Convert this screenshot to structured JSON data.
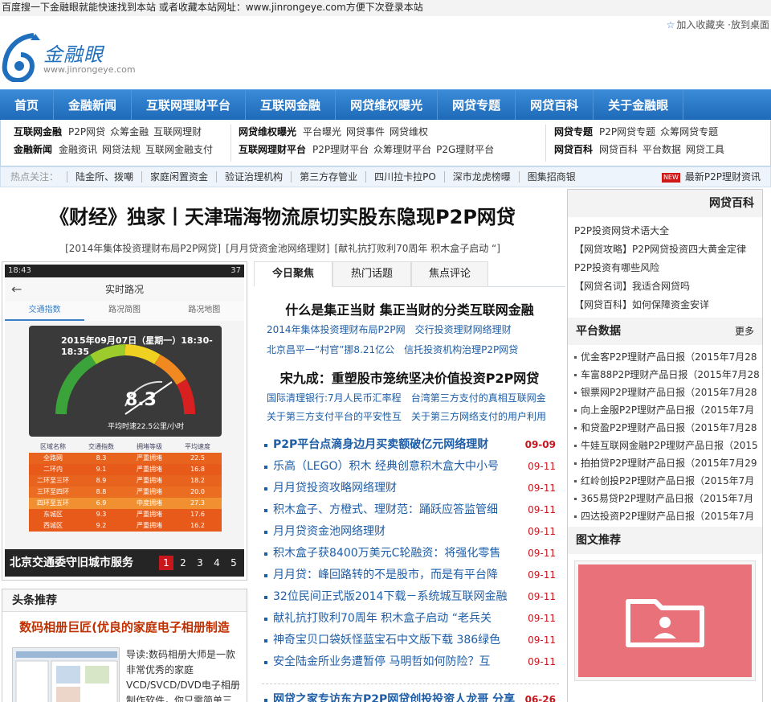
{
  "topbar": {
    "notice": "百度搜一下金融眼就能快速找到本站 或者收藏本站网址：www.jinrongeye.com方便下次登录本站",
    "bookmark": "加入收藏夹",
    "desktop": "·放到桌面"
  },
  "logo": {
    "cn": "金融眼",
    "en": "www.jinrongeye.com"
  },
  "nav": [
    "首页",
    "金融新闻",
    "互联网理财平台",
    "互联网金融",
    "网贷维权曝光",
    "网贷专题",
    "网贷百科",
    "关于金融眼"
  ],
  "subnav": {
    "g1": {
      "r1": {
        "head": "互联网金融",
        "items": [
          "P2P网贷",
          "众筹金融",
          "互联网理财"
        ]
      },
      "r2": {
        "head": "金融新闻",
        "items": [
          "金融资讯",
          "网贷法规",
          "互联网金融支付"
        ]
      }
    },
    "g2": {
      "r1": {
        "head": "网贷维权曝光",
        "items": [
          "平台曝光",
          "网贷事件",
          "网贷维权"
        ]
      },
      "r2": {
        "head": "互联网理财平台",
        "items": [
          "P2P理财平台",
          "众筹理财平台",
          "P2G理财平台"
        ]
      }
    },
    "g3": {
      "r1": {
        "head": "网贷专题",
        "items": [
          "P2P网贷专题",
          "众筹网贷专题"
        ]
      },
      "r2": {
        "head": "网贷百科",
        "items": [
          "网贷百科",
          "平台数据",
          "网贷工具"
        ]
      }
    }
  },
  "hotbar": {
    "label": "热点关注：",
    "items": [
      "陆金所、拨嘲",
      "家庭闲置资金",
      "验证治理机构",
      "第三方存管业",
      "四川拉卡拉PO",
      "深市龙虎榜曝",
      "图集招商银"
    ],
    "new_badge": "NEW",
    "new_label": "最新P2P理财资讯"
  },
  "headline": "《财经》独家丨天津瑞海物流原切实股东隐现P2P网贷",
  "subhead": [
    "[2014年集体投资理财布局P2P网贷]",
    "[月月贷资金池网络理财]",
    "[献礼抗打败利70周年 积木盒子启动 “]"
  ],
  "slide": {
    "status_time": "18:43",
    "status_right": "37",
    "app_title": "实时路况",
    "app_tabs": [
      "交通指数",
      "路况简图",
      "路况地图"
    ],
    "gauge_title": "2015年09月07日（星期一）18:30-18:35",
    "gauge_value": "8.3",
    "gauge_sub": "平均时速22.5公里/小时",
    "table_head": [
      "区域名称",
      "交通指数",
      "拥堵等级",
      "平均速度"
    ],
    "table_rows": [
      {
        "c": [
          "全路网",
          "8.3",
          "严重拥堵",
          "22.5"
        ],
        "color": "#e8641e"
      },
      {
        "c": [
          "二环内",
          "9.1",
          "严重拥堵",
          "16.8"
        ],
        "color": "#e85a1a"
      },
      {
        "c": [
          "二环至三环",
          "8.9",
          "严重拥堵",
          "18.2"
        ],
        "color": "#e8641e"
      },
      {
        "c": [
          "三环至四环",
          "8.8",
          "严重拥堵",
          "20.0"
        ],
        "color": "#ea6d22"
      },
      {
        "c": [
          "四环至五环",
          "6.9",
          "中度拥堵",
          "27.3"
        ],
        "color": "#f09030"
      },
      {
        "c": [
          "东城区",
          "9.3",
          "严重拥堵",
          "17.6"
        ],
        "color": "#e85a1a"
      },
      {
        "c": [
          "西城区",
          "9.2",
          "严重拥堵",
          "16.2"
        ],
        "color": "#e85a1a"
      }
    ],
    "caption": "北京交通委守旧城市服务",
    "pages": [
      "1",
      "2",
      "3",
      "4",
      "5"
    ]
  },
  "tabs": [
    "今日聚焦",
    "热门话题",
    "焦点评论"
  ],
  "focus1": {
    "title": "什么是集正当财 集正当财的分类互联网金融",
    "links": [
      [
        "2014年集体投资理财布局P2P网",
        "交行投资理财网络理财"
      ],
      [
        "北京昌平一“村官”挪8.21亿公",
        "信托投资机构治理P2P网贷"
      ]
    ]
  },
  "focus2": {
    "title": "宋九成：重塑股市笼统坚决价值投资P2P网贷",
    "links": [
      [
        "国际清理银行:7月人民币汇率程",
        "台湾第三方支付的真相互联网金"
      ],
      [
        "关于第三方支付平台的平安性互",
        "关于第三方网络支付的用户利用"
      ]
    ]
  },
  "news": [
    {
      "t": "P2P平台点滴身边月买卖额破亿元网络理财",
      "d": "09-09",
      "hl": true
    },
    {
      "t": "乐高（LEGO）积木 经典创意积木盒大中小号",
      "d": "09-11"
    },
    {
      "t": "月月贷投资攻略网络理财",
      "d": "09-11"
    },
    {
      "t": "积木盒子、方橙式、理财范：踊跃应答监管细",
      "d": "09-11"
    },
    {
      "t": "月月贷资金池网络理财",
      "d": "09-11"
    },
    {
      "t": "积木盒子获8400万美元C轮融资：将强化零售",
      "d": "09-11"
    },
    {
      "t": "月月贷：峰回路转的不是股市，而是有平台降",
      "d": "09-11"
    },
    {
      "t": "32位民间正式版2014下载－系统城互联网金融",
      "d": "09-11"
    },
    {
      "t": "献礼抗打败利70周年 积木盒子启动 “老兵关",
      "d": "09-11"
    },
    {
      "t": "神奇宝贝口袋妖怪蓝宝石中文版下载 386绿色",
      "d": "09-11"
    },
    {
      "t": "安全陆金所业务遭暂停 马明哲如何防险？互",
      "d": "09-11"
    },
    {
      "t": "网贷之家专访东方P2P网贷创投投资人龙哥 分享",
      "d": "06-26",
      "hl": true,
      "gap": true
    }
  ],
  "toutiao": {
    "head": "头条推荐",
    "title": "数码相册巨匠(优良的家庭电子相册制造",
    "desc": "导读:数码相册大师是一款非常优秀的家庭VCD/SVCD/DVD电子相册制作软件，你只需简单三"
  },
  "side": {
    "wiki_head": "网贷百科",
    "wiki": [
      "P2P投资网贷术语大全",
      "【网贷攻略】P2P网贷投资四大黄金定律",
      "P2P投资有哪些风险",
      "【网贷名词】我适合网贷吗",
      "【网贷百科】如何保障资金安详"
    ],
    "plat_head": "平台数据",
    "plat_more": "更多",
    "plat": [
      "优金客P2P理财产品日报（2015年7月28",
      "车富88P2P理财产品日报（2015年7月28",
      "银票网P2P理财产品日报（2015年7月28",
      "向上金服P2P理财产品日报（2015年7月",
      "和贷盈P2P理财产品日报（2015年7月28",
      "牛娃互联网金融P2P理财产品日报（2015",
      "拍拍贷P2P理财产品日报（2015年7月29",
      "红岭创投P2P理财产品日报（2015年7月",
      "365易贷P2P理财产品日报（2015年7月",
      "四达投资P2P理财产品日报（2015年7月"
    ],
    "pic_head": "图文推荐"
  },
  "colors": {
    "nav": "#1e6ab8",
    "date": "#c8161d",
    "link": "#1e5ea8",
    "pic": "#e8717a"
  }
}
